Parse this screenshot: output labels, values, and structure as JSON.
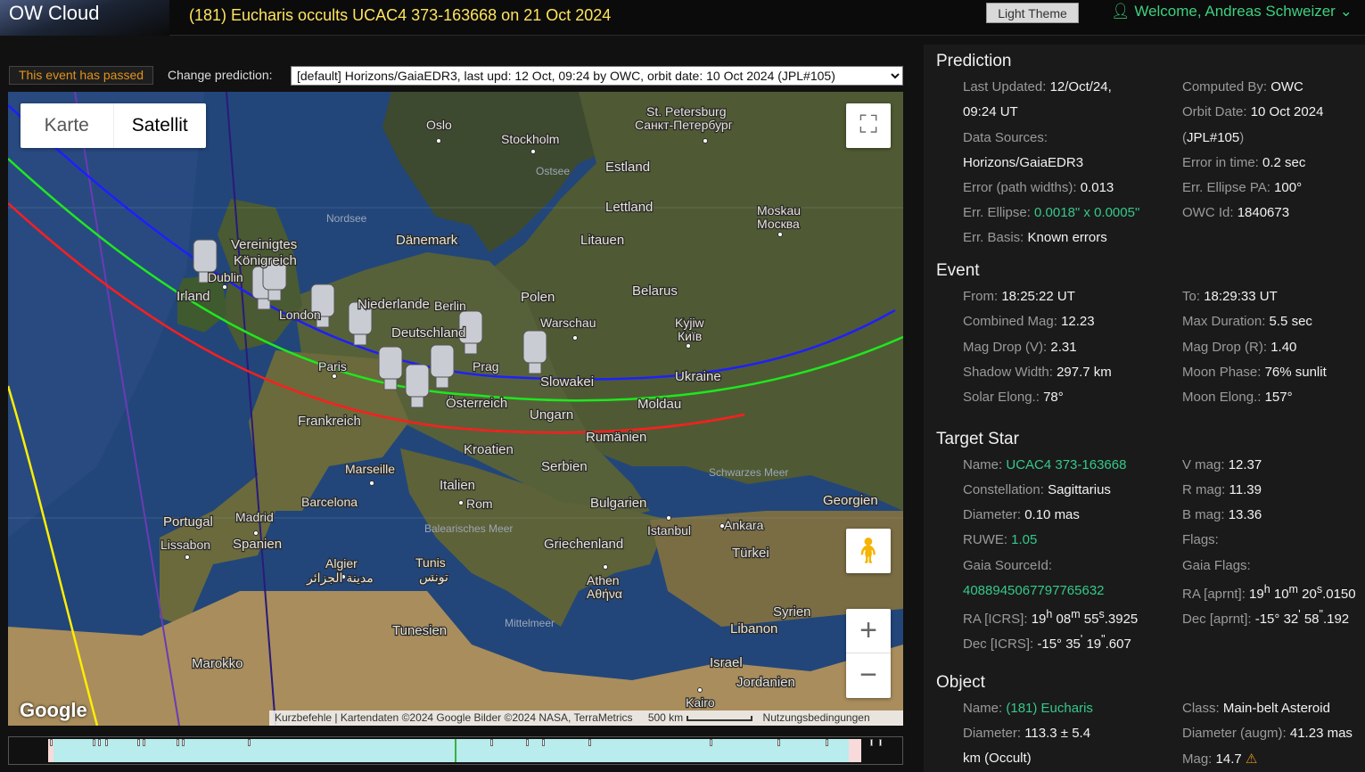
{
  "header": {
    "logo": "OW Cloud",
    "event_title": "(181) Eucharis occults UCAC4 373-163668 on 21 Oct 2024",
    "theme_button": "Light Theme",
    "welcome": "Welcome, Andreas Schweizer",
    "user_icon": "user-icon",
    "chevron_icon": "chevron-down-icon"
  },
  "toolbar": {
    "passed_badge": "This event has passed",
    "change_label": "Change prediction:",
    "prediction_selected": "[default] Horizons/GaiaEDR3, last upd: 12 Oct, 09:24 by OWC, orbit date: 10 Oct 2024 (JPL#105)"
  },
  "map": {
    "type_map": "Karte",
    "type_satellite": "Satellit",
    "google": "Google",
    "attrib_shortcuts": "Kurzbefehle",
    "attrib_data": "Kartendaten ©2024 Google Bilder ©2024 NASA, TerraMetrics",
    "attrib_scale": "500 km",
    "attrib_terms": "Nutzungsbedingungen",
    "labels": {
      "oslo": "Oslo",
      "stockholm": "Stockholm",
      "st_petersburg": "St. Petersburg",
      "st_petersburg_ru": "Санкт-Петербург",
      "ostsee": "Ostsee",
      "estland": "Estland",
      "lettland": "Lettland",
      "nordsee": "Nordsee",
      "moskau": "Moskau",
      "moskva": "Москва",
      "daenemark": "Dänemark",
      "litauen": "Litauen",
      "vereinigtes": "Vereinigtes",
      "koenigreich": "Königreich",
      "dublin": "Dublin",
      "irland": "Irland",
      "london": "London",
      "niederlande": "Niederlande",
      "berlin": "Berlin",
      "polen": "Polen",
      "belarus": "Belarus",
      "warschau": "Warschau",
      "kyjiw": "Kyjiw",
      "kyiv_ua": "Київ",
      "deutschland": "Deutschland",
      "paris": "Paris",
      "prag": "Prag",
      "slowakei": "Slowakei",
      "ukraine": "Ukraine",
      "oesterreich": "Österreich",
      "moldau": "Moldau",
      "ungarn": "Ungarn",
      "frankreich": "Frankreich",
      "rumaenien": "Rumänien",
      "kroatien": "Kroatien",
      "marseille": "Marseille",
      "serbien": "Serbien",
      "schwarzes_meer": "Schwarzes Meer",
      "italien": "Italien",
      "barcelona": "Barcelona",
      "rom": "Rom",
      "bulgarien": "Bulgarien",
      "georgien": "Georgien",
      "portugal": "Portugal",
      "madrid": "Madrid",
      "istanbul": "Istanbul",
      "ankara": "Ankara",
      "lissabon": "Lissabon",
      "spanien": "Spanien",
      "balearisches_meer": "Balearisches Meer",
      "griechenland": "Griechenland",
      "tuerkei": "Türkei",
      "algier": "Algier",
      "algier_ar": "مدينة الجزائر",
      "tunis": "Tunis",
      "tunis_ar": "تونس",
      "athen": "Athen",
      "athina": "Αθήνα",
      "syrien": "Syrien",
      "mittelmeer": "Mittelmeer",
      "tunesien": "Tunesien",
      "libanon": "Libanon",
      "marokko": "Marokko",
      "israel": "Israel",
      "jordanien": "Jordanien",
      "kairo": "Kairo"
    },
    "path_colors": {
      "north": "#1f1fff",
      "center": "#1ee81e",
      "south": "#ff1e1e",
      "sun": "#ffee00",
      "meridian": "#6a3bb5",
      "dark": "#2a1a7a"
    }
  },
  "info": {
    "prediction": {
      "title": "Prediction",
      "last_updated_label": "Last Updated:",
      "last_updated": "12/Oct/24,",
      "last_updated_time": "09:24 UT",
      "computed_by_label": "Computed By:",
      "computed_by": "OWC",
      "orbit_date_label": "Orbit Date:",
      "orbit_date": "10 Oct 2024",
      "orbit_jpl_open": "(",
      "orbit_jpl": "JPL#105",
      "orbit_jpl_close": ")",
      "data_sources_label": "Data Sources:",
      "data_sources": "Horizons/GaiaEDR3",
      "error_time_label": "Error in time:",
      "error_time": "0.2 sec",
      "error_path_label": "Error (path widths):",
      "error_path": "0.013",
      "ellipse_pa_label": "Err. Ellipse PA:",
      "ellipse_pa": "100°",
      "ellipse_label": "Err. Ellipse:",
      "ellipse": "0.0018\" x 0.0005\"",
      "owc_id_label": "OWC Id:",
      "owc_id": "1840673",
      "err_basis_label": "Err. Basis:",
      "err_basis": "Known errors"
    },
    "event": {
      "title": "Event",
      "from_label": "From:",
      "from": "18:25:22 UT",
      "to_label": "To:",
      "to": "18:29:33 UT",
      "combined_mag_label": "Combined Mag:",
      "combined_mag": "12.23",
      "max_duration_label": "Max Duration:",
      "max_duration": "5.5 sec",
      "mag_drop_v_label": "Mag Drop (V):",
      "mag_drop_v": "2.31",
      "mag_drop_r_label": "Mag Drop (R):",
      "mag_drop_r": "1.40",
      "shadow_width_label": "Shadow Width:",
      "shadow_width": "297.7 km",
      "moon_phase_label": "Moon Phase:",
      "moon_phase": "76% sunlit",
      "solar_elong_label": "Solar Elong.:",
      "solar_elong": "78°",
      "moon_elong_label": "Moon Elong.:",
      "moon_elong": "157°"
    },
    "star": {
      "title": "Target Star",
      "name_label": "Name:",
      "name": "UCAC4 373-163668",
      "vmag_label": "V mag:",
      "vmag": "12.37",
      "constellation_label": "Constellation:",
      "constellation": "Sagittarius",
      "rmag_label": "R mag:",
      "rmag": "11.39",
      "diameter_label": "Diameter:",
      "diameter": "0.10 mas",
      "bmag_label": "B mag:",
      "bmag": "13.36",
      "ruwe_label": "RUWE:",
      "ruwe": "1.05",
      "flags_label": "Flags:",
      "gaia_id_label": "Gaia SourceId:",
      "gaia_id": "4088945067797765632",
      "gaia_flags_label": "Gaia Flags:",
      "ra_aprnt_label": "RA [aprnt]:",
      "ra_aprnt_h": "19",
      "ra_aprnt_m": "10",
      "ra_aprnt_s": "20",
      "ra_aprnt_frac": "0150",
      "ra_icrs_label": "RA [ICRS]:",
      "ra_icrs_h": "19",
      "ra_icrs_m": "08",
      "ra_icrs_s": "55",
      "ra_icrs_frac": "3925",
      "dec_aprnt_label": "Dec [aprnt]:",
      "dec_aprnt_d": "-15°",
      "dec_aprnt_m": "32",
      "dec_aprnt_s": "58",
      "dec_aprnt_frac": "192",
      "dec_icrs_label": "Dec [ICRS]:",
      "dec_icrs_d": "-15°",
      "dec_icrs_m": "35",
      "dec_icrs_s": "19",
      "dec_icrs_frac": "607",
      "unit_h": "h",
      "unit_m": "m",
      "unit_s": "s",
      "unit_amin": "'",
      "unit_asec": "\""
    },
    "object": {
      "title": "Object",
      "name_label": "Name:",
      "name": "(181) Eucharis",
      "class_label": "Class:",
      "class": "Main-belt Asteroid",
      "diameter_label": "Diameter:",
      "diameter": "113.3 ± 5.4",
      "diameter_unit": "km",
      "diameter_note": "(Occult)",
      "diameter_augm_label": "Diameter (augm):",
      "diameter_augm": "41.23 mas",
      "mag_label": "Mag:",
      "mag": "14.7",
      "warning_icon": "warning-icon"
    }
  }
}
